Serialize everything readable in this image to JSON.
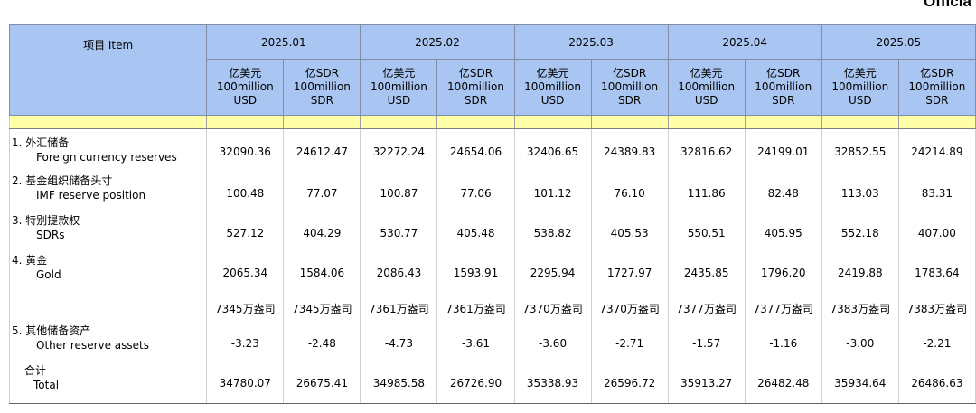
{
  "corner_title": "Officia",
  "header": {
    "item_label": "项目 Item",
    "months": [
      "2025.01",
      "2025.02",
      "2025.03",
      "2025.04",
      "2025.05",
      ""
    ],
    "usd_unit": [
      "亿美元",
      "100million",
      "USD"
    ],
    "sdr_unit": [
      "亿SDR",
      "100million",
      "SDR"
    ],
    "partial_unit": [
      "亿",
      "10"
    ]
  },
  "rows": [
    {
      "zh": "1.  外汇储备",
      "en": "Foreign currency reserves",
      "values": [
        "32090.36",
        "24612.47",
        "32272.24",
        "24654.06",
        "32406.65",
        "24389.83",
        "32816.62",
        "24199.01",
        "32852.55",
        "24214.89"
      ]
    },
    {
      "zh": "2.  基金组织储备头寸",
      "en": "IMF reserve position",
      "values": [
        "100.48",
        "77.07",
        "100.87",
        "77.06",
        "101.12",
        "76.10",
        "111.86",
        "82.48",
        "113.03",
        "83.31"
      ]
    },
    {
      "zh": "3.  特别提款权",
      "en": "SDRs",
      "values": [
        "527.12",
        "404.29",
        "530.77",
        "405.48",
        "538.82",
        "405.53",
        "550.51",
        "405.95",
        "552.18",
        "407.00"
      ]
    },
    {
      "zh": "4.  黄金",
      "en": "Gold",
      "values": [
        "2065.34",
        "1584.06",
        "2086.43",
        "1593.91",
        "2295.94",
        "1727.97",
        "2435.85",
        "1796.20",
        "2419.88",
        "1783.64"
      ]
    },
    {
      "zh": "",
      "en": "",
      "values": [
        "7345万盎司",
        "7345万盎司",
        "7361万盎司",
        "7361万盎司",
        "7370万盎司",
        "7370万盎司",
        "7377万盎司",
        "7377万盎司",
        "7383万盎司",
        "7383万盎司"
      ]
    },
    {
      "zh": "5.  其他储备资产",
      "en": "Other reserve assets",
      "values": [
        "-3.23",
        "-2.48",
        "-4.73",
        "-3.61",
        "-3.60",
        "-2.71",
        "-1.57",
        "-1.16",
        "-3.00",
        "-2.21"
      ]
    },
    {
      "zh": "合计",
      "en": "Total",
      "values": [
        "34780.07",
        "26675.41",
        "34985.58",
        "26726.90",
        "35338.93",
        "26596.72",
        "35913.27",
        "26482.48",
        "35934.64",
        "26486.63"
      ]
    }
  ]
}
